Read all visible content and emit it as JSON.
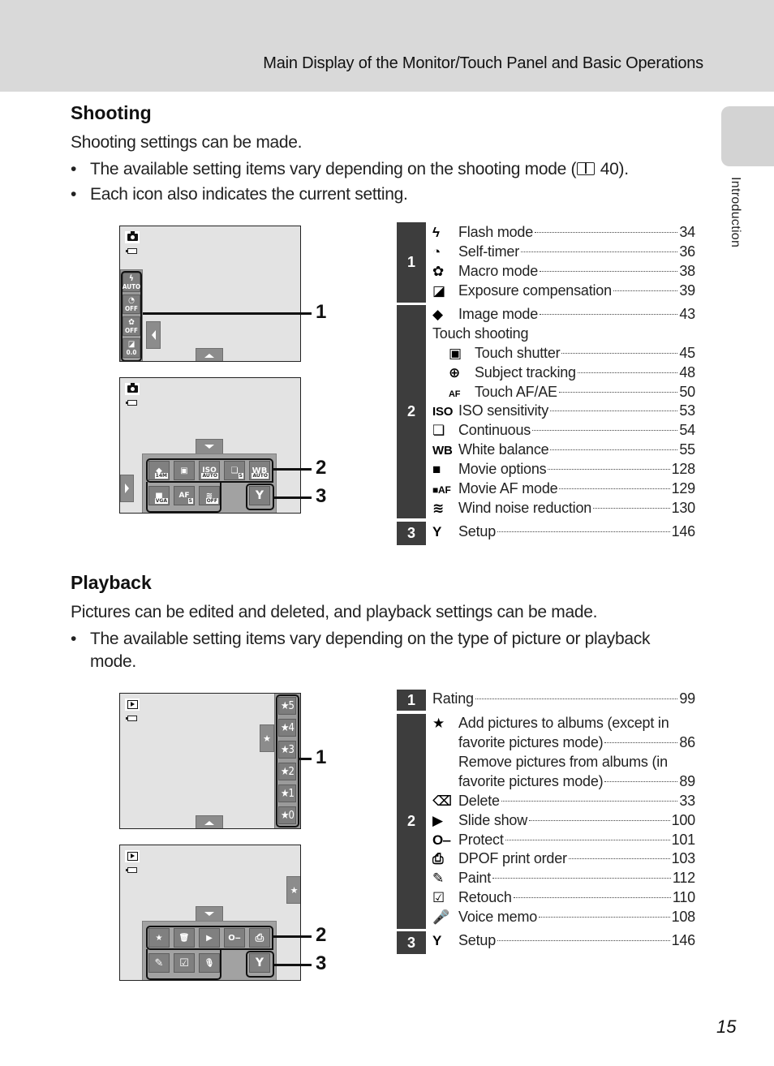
{
  "header": {
    "title": "Main Display of the Monitor/Touch Panel and Basic Operations"
  },
  "side_tab": {
    "label": "Introduction"
  },
  "shooting": {
    "title": "Shooting",
    "intro": "Shooting settings can be made.",
    "bullets": [
      {
        "before": "The available setting items vary depending on the shooting mode (",
        "ref": "40",
        "after": ")."
      },
      {
        "text": "Each icon also indicates the current setting."
      }
    ],
    "screen1": {
      "mode_icon": "camera-icon",
      "side_buttons": [
        {
          "icon": "flash-icon",
          "glyph": "ϟ",
          "value": "AUTO"
        },
        {
          "icon": "self-timer-icon",
          "glyph": "◔",
          "value": "OFF"
        },
        {
          "icon": "macro-icon",
          "glyph": "✿",
          "value": "OFF"
        },
        {
          "icon": "exposure-comp-icon",
          "glyph": "◪",
          "value": "0.0"
        }
      ],
      "callout": "1"
    },
    "screen2": {
      "mode_icon": "camera-icon",
      "row1": [
        {
          "icon": "image-mode-icon",
          "glyph": "◆",
          "value": "14M"
        },
        {
          "icon": "touch-shutter-icon",
          "glyph": "▣",
          "value": ""
        },
        {
          "icon": "iso-icon",
          "glyph": "ISO",
          "value": "AUTO"
        },
        {
          "icon": "continuous-icon",
          "glyph": "❏",
          "value": "S"
        },
        {
          "icon": "white-balance-icon",
          "glyph": "WB",
          "value": "AUTO"
        }
      ],
      "row2": [
        {
          "icon": "movie-options-icon",
          "glyph": "■",
          "value": "VGA"
        },
        {
          "icon": "movie-af-icon",
          "glyph": "AF",
          "value": "S"
        },
        {
          "icon": "wind-noise-icon",
          "glyph": "≋",
          "value": "OFF"
        }
      ],
      "setup": {
        "icon": "wrench-icon",
        "glyph": "Y"
      },
      "callouts": [
        "2",
        "3"
      ]
    },
    "index": {
      "groups": [
        {
          "num": "1",
          "items": [
            {
              "icon": "flash-icon",
              "glyph": "ϟ",
              "label": "Flash mode",
              "page": "34"
            },
            {
              "icon": "self-timer-icon",
              "glyph": "◔",
              "label": "Self-timer",
              "page": "36"
            },
            {
              "icon": "macro-icon",
              "glyph": "✿",
              "label": "Macro mode",
              "page": "38"
            },
            {
              "icon": "exposure-comp-icon",
              "glyph": "◪",
              "label": "Exposure compensation",
              "page": "39"
            }
          ]
        },
        {
          "num": "2",
          "items": [
            {
              "icon": "image-mode-icon",
              "glyph": "◆",
              "label": "Image mode",
              "page": "43"
            },
            {
              "heading": "Touch shooting"
            },
            {
              "icon": "touch-shutter-icon",
              "glyph": "▣",
              "label": "Touch shutter",
              "page": "45",
              "sub": true
            },
            {
              "icon": "subject-tracking-icon",
              "glyph": "⊕",
              "label": "Subject tracking",
              "page": "48",
              "sub": true
            },
            {
              "icon": "touch-af-ae-icon",
              "glyph": "AF",
              "label": "Touch AF/AE",
              "page": "50",
              "sub": true
            },
            {
              "icon": "iso-icon",
              "glyph": "ISO",
              "label": "ISO sensitivity",
              "page": "53"
            },
            {
              "icon": "continuous-icon",
              "glyph": "❏",
              "label": "Continuous",
              "page": "54"
            },
            {
              "icon": "white-balance-icon",
              "glyph": "WB",
              "label": "White balance",
              "page": "55"
            },
            {
              "icon": "movie-options-icon",
              "glyph": "■",
              "label": "Movie options",
              "page": "128"
            },
            {
              "icon": "movie-af-icon",
              "glyph": "■AF",
              "label": "Movie AF mode",
              "page": "129"
            },
            {
              "icon": "wind-noise-icon",
              "glyph": "≋",
              "label": "Wind noise reduction",
              "page": "130"
            }
          ]
        },
        {
          "num": "3",
          "items": [
            {
              "icon": "wrench-icon",
              "glyph": "Y",
              "label": "Setup",
              "page": "146"
            }
          ]
        }
      ]
    }
  },
  "playback": {
    "title": "Playback",
    "intro": "Pictures can be edited and deleted, and playback settings can be made.",
    "bullets": [
      {
        "text": "The available setting items vary depending on the type of picture or playback mode."
      }
    ],
    "screen1": {
      "mode_icon": "play-icon",
      "rating_tab_glyph": "★",
      "ratings": [
        "★5",
        "★4",
        "★3",
        "★2",
        "★1",
        "★0"
      ],
      "callout": "1"
    },
    "screen2": {
      "mode_icon": "play-icon",
      "rating_tab_glyph": "★",
      "row1": [
        {
          "icon": "album-icon",
          "glyph": "★"
        },
        {
          "icon": "delete-icon",
          "glyph": "🗑"
        },
        {
          "icon": "slide-show-icon",
          "glyph": "▶"
        },
        {
          "icon": "protect-key-icon",
          "glyph": "O‒"
        },
        {
          "icon": "print-order-icon",
          "glyph": "⎙"
        }
      ],
      "row2": [
        {
          "icon": "paint-icon",
          "glyph": "✎"
        },
        {
          "icon": "retouch-icon",
          "glyph": "☑"
        },
        {
          "icon": "voice-memo-icon",
          "glyph": "🎙"
        }
      ],
      "setup": {
        "icon": "wrench-icon",
        "glyph": "Y"
      },
      "callouts": [
        "2",
        "3"
      ]
    },
    "index": {
      "groups": [
        {
          "num": "1",
          "items": [
            {
              "label": "Rating",
              "page": "99"
            }
          ]
        },
        {
          "num": "2",
          "items": [
            {
              "icon": "album-icon",
              "glyph": "★",
              "label_line1": "Add pictures to albums (except in",
              "label": "favorite pictures mode)",
              "page": "86"
            },
            {
              "label_line1": "Remove pictures from albums (in",
              "label": "favorite pictures mode)",
              "page": "89"
            },
            {
              "icon": "delete-icon",
              "glyph": "⌫",
              "label": "Delete",
              "page": "33"
            },
            {
              "icon": "slide-show-icon",
              "glyph": "▶",
              "label": "Slide show",
              "page": "100"
            },
            {
              "icon": "protect-key-icon",
              "glyph": "O‒",
              "label": "Protect",
              "page": "101"
            },
            {
              "icon": "print-order-icon",
              "glyph": "⎙",
              "label": "DPOF print order",
              "page": "103"
            },
            {
              "icon": "paint-icon",
              "glyph": "✎",
              "label": "Paint",
              "page": "112"
            },
            {
              "icon": "retouch-icon",
              "glyph": "☑",
              "label": "Retouch",
              "page": "110"
            },
            {
              "icon": "voice-memo-icon",
              "glyph": "🎤",
              "label": "Voice memo",
              "page": "108"
            }
          ]
        },
        {
          "num": "3",
          "items": [
            {
              "icon": "wrench-icon",
              "glyph": "Y",
              "label": "Setup",
              "page": "146"
            }
          ]
        }
      ]
    }
  },
  "page_number": "15"
}
